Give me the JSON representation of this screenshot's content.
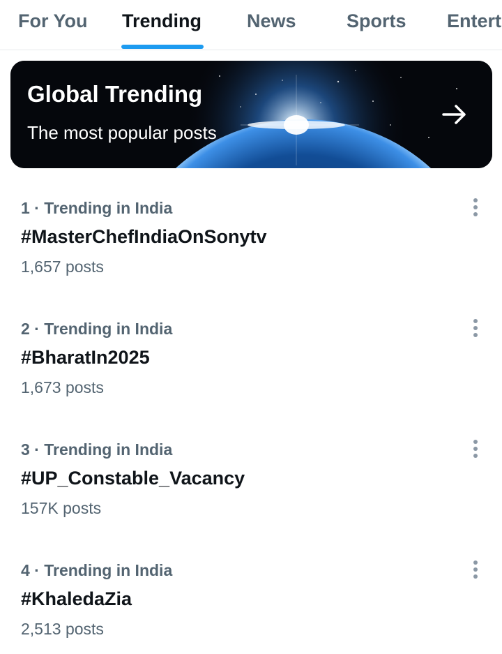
{
  "tabs": [
    {
      "label": "For You",
      "active": false
    },
    {
      "label": "Trending",
      "active": true
    },
    {
      "label": "News",
      "active": false
    },
    {
      "label": "Sports",
      "active": false
    },
    {
      "label": "Entert",
      "active": false
    }
  ],
  "hero": {
    "title": "Global Trending",
    "subtitle": "The most popular posts",
    "icon": "arrow-right-icon"
  },
  "trends": [
    {
      "rank": "1",
      "meta": "1 · Trending in India",
      "tag": "#MasterChefIndiaOnSonytv",
      "count": "1,657 posts"
    },
    {
      "rank": "2",
      "meta": "2 · Trending in India",
      "tag": "#BharatIn2025",
      "count": "1,673 posts"
    },
    {
      "rank": "3",
      "meta": "3 · Trending in India",
      "tag": "#UP_Constable_Vacancy",
      "count": "157K posts"
    },
    {
      "rank": "4",
      "meta": "4 · Trending in India",
      "tag": "#KhaledaZia",
      "count": "2,513 posts"
    }
  ],
  "colors": {
    "accent": "#1d9bf0",
    "text_primary": "#0f1419",
    "text_secondary": "#536471"
  }
}
